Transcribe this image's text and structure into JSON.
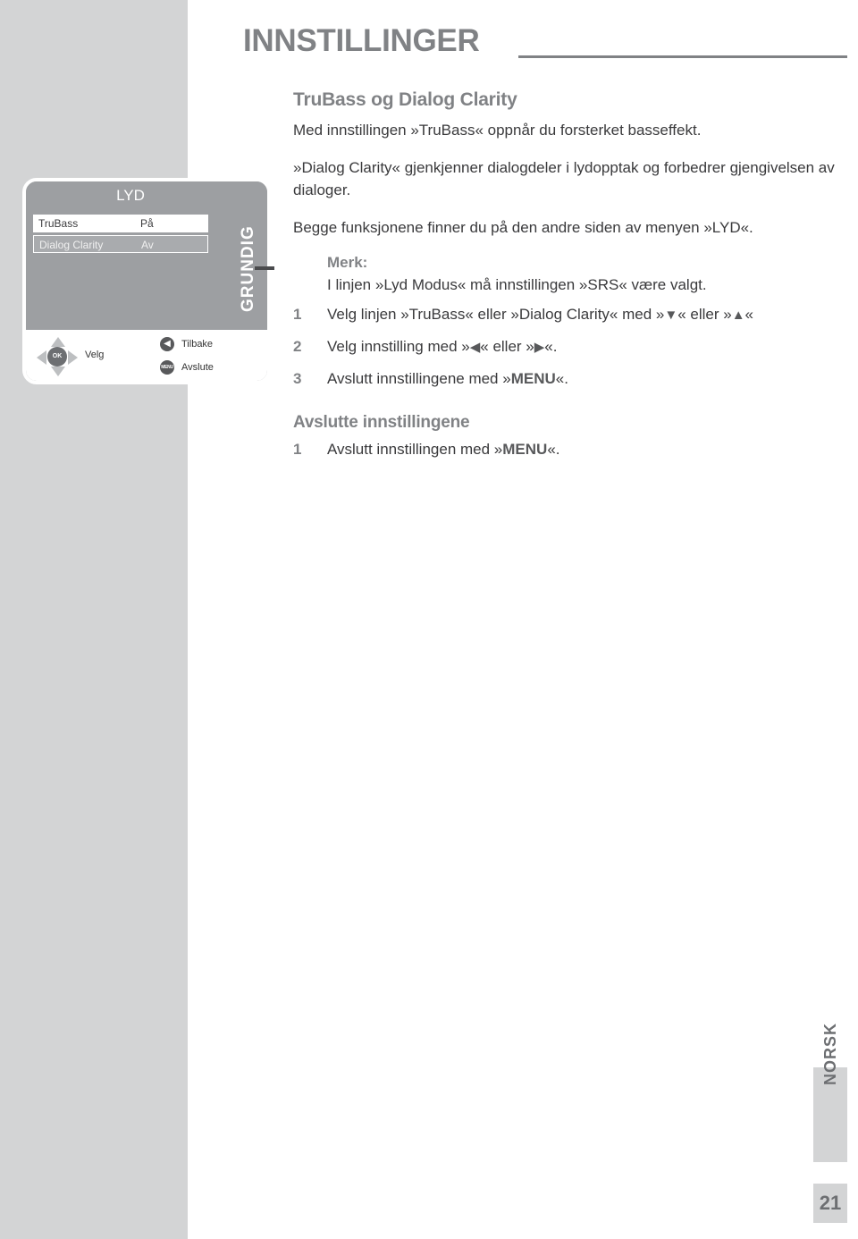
{
  "page": {
    "title": "INNSTILLINGER",
    "language_tab": "NORSK",
    "page_number": "21"
  },
  "colors": {
    "heading_gray": "#808285",
    "body_gray": "#3a3a3c",
    "band_gray": "#d3d4d5",
    "panel_gray": "#9d9fa2",
    "dark_gray": "#58595b"
  },
  "tv_menu": {
    "header_title": "LYD",
    "brand": "GRUNDIG",
    "rows": [
      {
        "label": "TruBass",
        "value": "På",
        "selected": false
      },
      {
        "label": "Dialog Clarity",
        "value": "Av",
        "selected": true
      }
    ],
    "footer": {
      "dpad": {
        "ok_label": "OK",
        "label": "Velg"
      },
      "back": {
        "icon": "arrow-left-icon",
        "label": "Tilbake"
      },
      "exit": {
        "icon": "menu-button-icon",
        "button_text": "MENU",
        "label": "Avslute"
      }
    }
  },
  "content": {
    "section_heading": "TruBass og Dialog Clarity",
    "paragraph_1": "Med innstillingen »TruBass« oppnår du forsterket basseffekt.",
    "paragraph_2": "»Dialog Clarity« gjenkjenner dialogdeler i lydopptak og forbedrer gjengivelsen av dialoger.",
    "paragraph_3": "Begge funksjonene finner du på den andre siden av menyen »LYD«.",
    "note": {
      "title": "Merk:",
      "text": "I linjen »Lyd Modus« må innstillingen »SRS« være valgt."
    },
    "steps": [
      {
        "num": "1",
        "prefix": "Velg linjen »TruBass« eller »Dialog Clarity« med »",
        "glyph_a": "▼",
        "middle": "« eller »",
        "glyph_b": "▲",
        "suffix": "«"
      },
      {
        "num": "2",
        "prefix": "Velg innstilling med »",
        "glyph_a": "◀",
        "middle": "« eller »",
        "glyph_b": "▶",
        "suffix": "«."
      },
      {
        "num": "3",
        "prefix": "Avslutt innstillingene med »",
        "key": "MENU",
        "suffix": "«."
      }
    ],
    "sub_heading": "Avslutte innstillingene",
    "sub_steps": [
      {
        "num": "1",
        "prefix": "Avslutt innstillingen med »",
        "key": "MENU",
        "suffix": "«."
      }
    ]
  }
}
